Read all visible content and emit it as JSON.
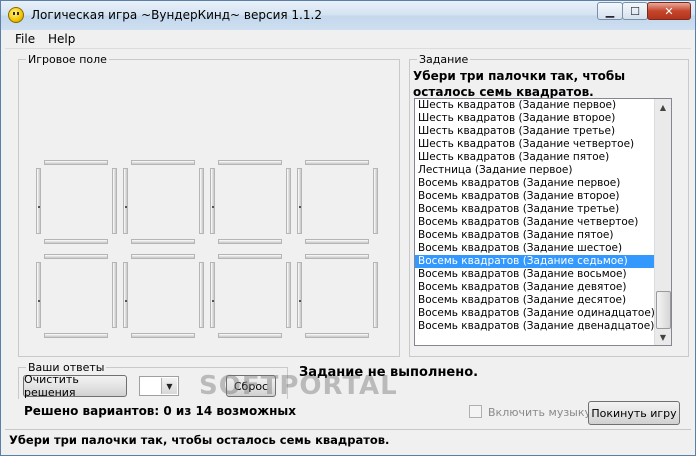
{
  "window": {
    "title": "Логическая игра ~ВундерКинд~ версия 1.1.2"
  },
  "menu": {
    "file": "File",
    "help": "Help"
  },
  "game_field": {
    "label": "Игровое поле"
  },
  "task": {
    "label": "Задание",
    "text": "Убери три палочки так, чтобы осталось семь  квадратов.",
    "items": [
      "Шесть квадратов (Задание первое)",
      "Шесть квадратов (Задание второе)",
      "Шесть квадратов (Задание третье)",
      "Шесть квадратов (Задание четвертое)",
      "Шесть квадратов (Задание пятое)",
      "Лестница (Задание первое)",
      "Восемь квадратов (Задание первое)",
      "Восемь квадратов (Задание второе)",
      "Восемь квадратов (Задание третье)",
      "Восемь квадратов (Задание четвертое)",
      "Восемь квадратов (Задание пятое)",
      "Восемь квадратов (Задание шестое)",
      "Восемь квадратов (Задание седьмое)",
      "Восемь квадратов (Задание восьмое)",
      "Восемь квадратов (Задание девятое)",
      "Восемь квадратов (Задание десятое)",
      "Восемь квадратов (Задание одинадцатое)",
      "Восемь квадратов (Задание двенадцатое)"
    ],
    "selected_index": 12
  },
  "answers": {
    "label": "Ваши ответы",
    "clear_button": "Очистить решения",
    "reset_button": "Сброс",
    "solved_text": "Решено вариантов: 0 из 14 возможных"
  },
  "status_message": "Задание не выполнено.",
  "music_checkbox": {
    "label": "Включить музыку",
    "checked": false
  },
  "quit_button": "Покинуть игру",
  "statusbar": "Убери три палочки так, чтобы осталось семь  квадратов.",
  "watermark": "SOFTPORTAL"
}
